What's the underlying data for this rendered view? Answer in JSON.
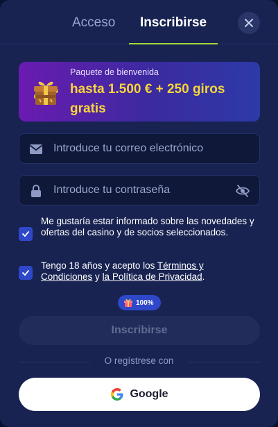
{
  "tabs": {
    "login_label": "Acceso",
    "signup_label": "Inscribirse",
    "active": "signup"
  },
  "close_icon": "close-icon",
  "banner": {
    "subtitle": "Paquete de bienvenida",
    "title": "hasta 1.500 € + 250 giros gratis",
    "icon": "gift-icon"
  },
  "form": {
    "email_placeholder": "Introduce tu correo electrónico",
    "password_placeholder": "Introduce tu contraseña"
  },
  "consents": {
    "newsletter_text": "Me gustaría estar informado sobre las novedades y ofertas del casino y de socios seleccionados.",
    "newsletter_checked": true,
    "terms_prefix": "Tengo 18 años y acepto los ",
    "terms_link": "Términos y Condiciones",
    "terms_middle": " y ",
    "privacy_link": "la Política de Privacidad",
    "terms_suffix": ".",
    "terms_checked": true
  },
  "badge": {
    "text": "100%",
    "icon": "gift-icon"
  },
  "signup_button": {
    "label": "Inscribirse"
  },
  "divider_text": "O regístrese con",
  "google_button": {
    "label": "Google",
    "icon": "google-icon"
  },
  "colors": {
    "background": "#182352",
    "accent": "#a6d83a",
    "checkbox": "#2f48c9",
    "banner_title": "#f8d53a"
  }
}
